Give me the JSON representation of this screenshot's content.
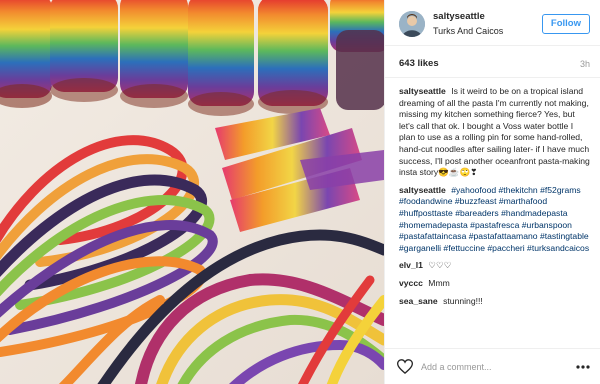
{
  "post": {
    "username": "saltyseattle",
    "location": "Turks And Caicos",
    "follow_label": "Follow",
    "likes": "643 likes",
    "time": "3h",
    "caption": "Is it weird to be on a tropical island dreaming of all the pasta I'm currently not making, missing my kitchen something fierce? Yes, but let's call that ok. I bought a Voss water bottle I plan to use as a rolling pin for some hand-rolled, hand-cut noodles after sailing later- if I have much success, I'll post another oceanfront pasta-making insta story😎☕🙄❣",
    "hashtags": "#yahoofood #thekitchn #f52grams #foodandwine #buzzfeast #marthafood #huffposttaste #bareaders #handmadepasta #homemadepasta #pastafresca #urbanspoon #pastafattaincasa #pastafattaamano #tastingtable #garganelli #fettuccine #paccheri #turksandcaicos",
    "comments": [
      {
        "user": "elv_l1",
        "text": "♡♡♡"
      },
      {
        "user": "vyccc",
        "text": "Mmm"
      },
      {
        "user": "sea_sane",
        "text": "stunning!!!"
      }
    ],
    "add_comment_placeholder": "Add a comment...",
    "icons": {
      "like": "heart-icon",
      "more": "more-options-icon"
    }
  }
}
